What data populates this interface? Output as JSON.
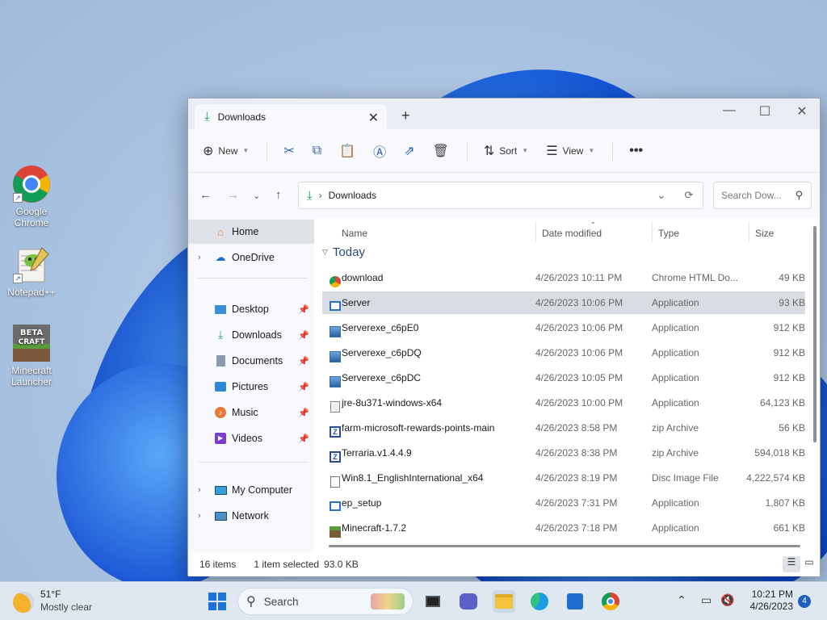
{
  "desktop": {
    "icons": [
      {
        "label": "Google Chrome",
        "icon": "chrome-icon"
      },
      {
        "label": "Notepad++",
        "icon": "notepad-plus-plus-icon"
      },
      {
        "label": "Minecraft Launcher",
        "icon": "minecraft-beta-craft-icon"
      }
    ]
  },
  "window": {
    "tab_title": "Downloads",
    "toolbar": {
      "new_label": "New",
      "sort_label": "Sort",
      "view_label": "View"
    },
    "address": {
      "path": "Downloads"
    },
    "search": {
      "placeholder": "Search Dow..."
    },
    "sidebar": {
      "items": [
        {
          "label": "Home",
          "icon": "home-icon"
        },
        {
          "label": "OneDrive",
          "icon": "cloud-icon"
        },
        {
          "label": "Desktop",
          "icon": "desktop-icon"
        },
        {
          "label": "Downloads",
          "icon": "download-icon"
        },
        {
          "label": "Documents",
          "icon": "documents-icon"
        },
        {
          "label": "Pictures",
          "icon": "pictures-icon"
        },
        {
          "label": "Music",
          "icon": "music-icon"
        },
        {
          "label": "Videos",
          "icon": "videos-icon"
        },
        {
          "label": "My Computer",
          "icon": "computer-icon"
        },
        {
          "label": "Network",
          "icon": "network-icon"
        }
      ]
    },
    "columns": {
      "name": "Name",
      "date": "Date modified",
      "type": "Type",
      "size": "Size"
    },
    "group_label": "Today",
    "files": [
      {
        "name": "download",
        "date": "4/26/2023 10:11 PM",
        "type": "Chrome HTML Do...",
        "size": "49 KB",
        "icon": "chrome-file-icon"
      },
      {
        "name": "Server",
        "date": "4/26/2023 10:06 PM",
        "type": "Application",
        "size": "93 KB",
        "icon": "app-icon"
      },
      {
        "name": "Serverexe_c6pE0",
        "date": "4/26/2023 10:06 PM",
        "type": "Application",
        "size": "912 KB",
        "icon": "installer-icon"
      },
      {
        "name": "Serverexe_c6pDQ",
        "date": "4/26/2023 10:06 PM",
        "type": "Application",
        "size": "912 KB",
        "icon": "installer-icon"
      },
      {
        "name": "Serverexe_c6pDC",
        "date": "4/26/2023 10:05 PM",
        "type": "Application",
        "size": "912 KB",
        "icon": "installer-icon"
      },
      {
        "name": "jre-8u371-windows-x64",
        "date": "4/26/2023 10:00 PM",
        "type": "Application",
        "size": "64,123 KB",
        "icon": "java-installer-icon"
      },
      {
        "name": "farm-microsoft-rewards-points-main",
        "date": "4/26/2023 8:58 PM",
        "type": "zip Archive",
        "size": "56 KB",
        "icon": "zip-icon"
      },
      {
        "name": "Terraria.v1.4.4.9",
        "date": "4/26/2023 8:38 PM",
        "type": "zip Archive",
        "size": "594,018 KB",
        "icon": "zip-icon"
      },
      {
        "name": "Win8.1_EnglishInternational_x64",
        "date": "4/26/2023 8:19 PM",
        "type": "Disc Image File",
        "size": "4,222,574 KB",
        "icon": "disc-image-icon"
      },
      {
        "name": "ep_setup",
        "date": "4/26/2023 7:31 PM",
        "type": "Application",
        "size": "1,807 KB",
        "icon": "app-icon"
      },
      {
        "name": "Minecraft-1.7.2",
        "date": "4/26/2023 7:18 PM",
        "type": "Application",
        "size": "661 KB",
        "icon": "minecraft-icon"
      }
    ],
    "status": {
      "item_count": "16 items",
      "selection": "1 item selected",
      "selection_size": "93.0 KB"
    }
  },
  "taskbar": {
    "weather_temp": "51°F",
    "weather_desc": "Mostly clear",
    "search_label": "Search",
    "time": "10:21 PM",
    "date": "4/26/2023",
    "notification_count": "4"
  },
  "colors": {
    "accent": "#1f5fb8",
    "selected_row": "#d8dde3",
    "download_green": "#1a9e5a"
  }
}
